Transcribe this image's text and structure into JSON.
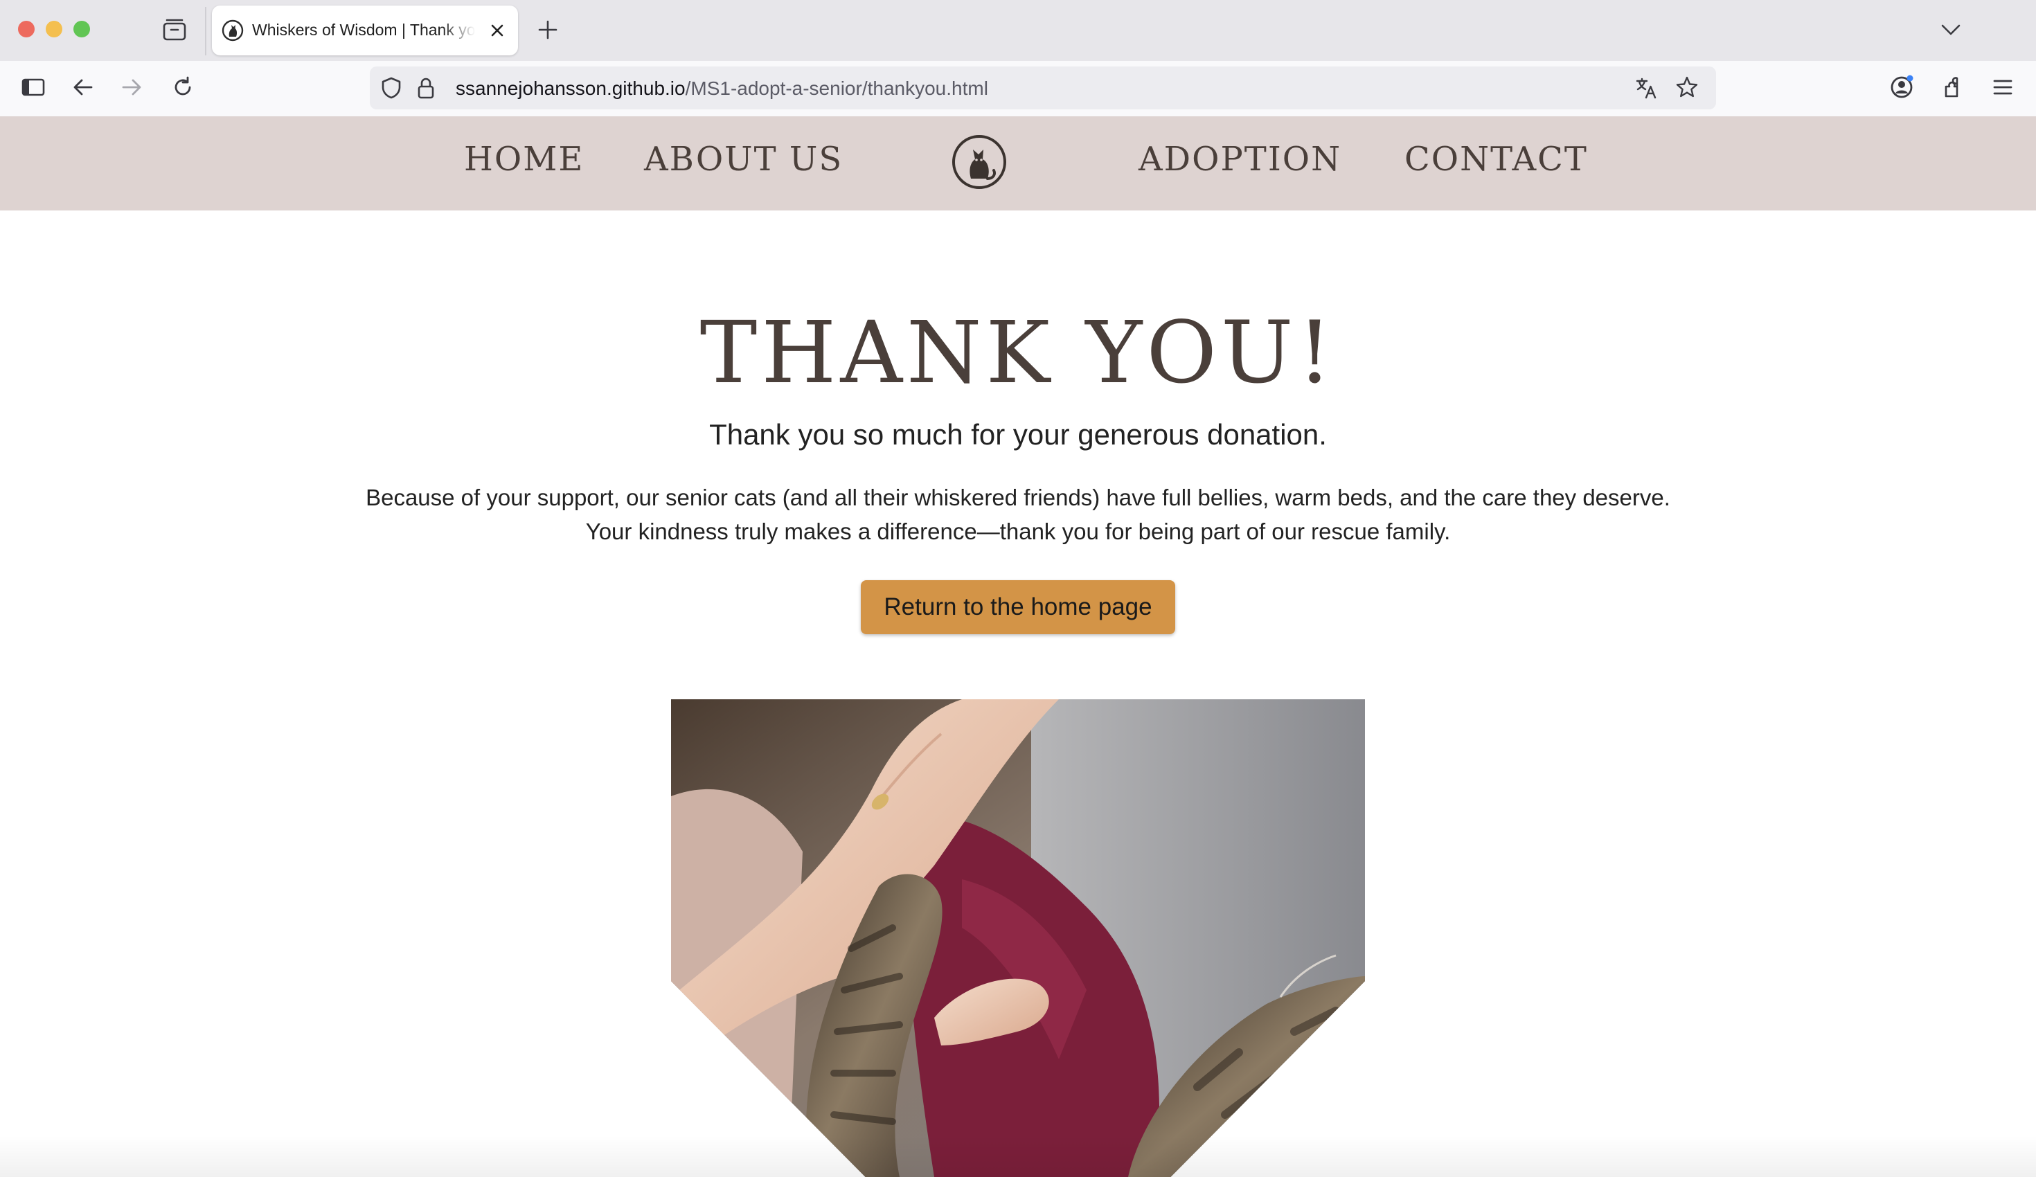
{
  "browser": {
    "tab_title": "Whiskers of Wisdom | Thank you",
    "url_host": "ssannejohansson.github.io",
    "url_path": "/MS1-adopt-a-senior/thankyou.html",
    "icons": [
      "tab-overview-icon",
      "close-icon",
      "plus-icon",
      "chevron-down-icon",
      "sidebar-icon",
      "back-arrow-icon",
      "forward-arrow-icon",
      "reload-icon",
      "shield-icon",
      "lock-icon",
      "translate-icon",
      "star-icon",
      "account-icon",
      "extensions-icon",
      "menu-icon"
    ]
  },
  "nav": {
    "home": "HOME",
    "about": "ABOUT US",
    "adoption": "ADOPTION",
    "contact": "CONTACT",
    "logo_icon": "cat-logo-icon"
  },
  "main": {
    "title": "THANK YOU!",
    "subtitle": "Thank you so much for your generous donation.",
    "para_line1": "Because of your support, our senior cats (and all their whiskered friends) have full bellies, warm beds, and the care they deserve.",
    "para_line2": "Your kindness truly makes a difference—thank you for being part of our rescue family.",
    "cta_label": "Return to the home page"
  },
  "colors": {
    "nav_bg": "#ded3d1",
    "heading": "#4a3f3a",
    "cta_bg": "#d39447"
  }
}
